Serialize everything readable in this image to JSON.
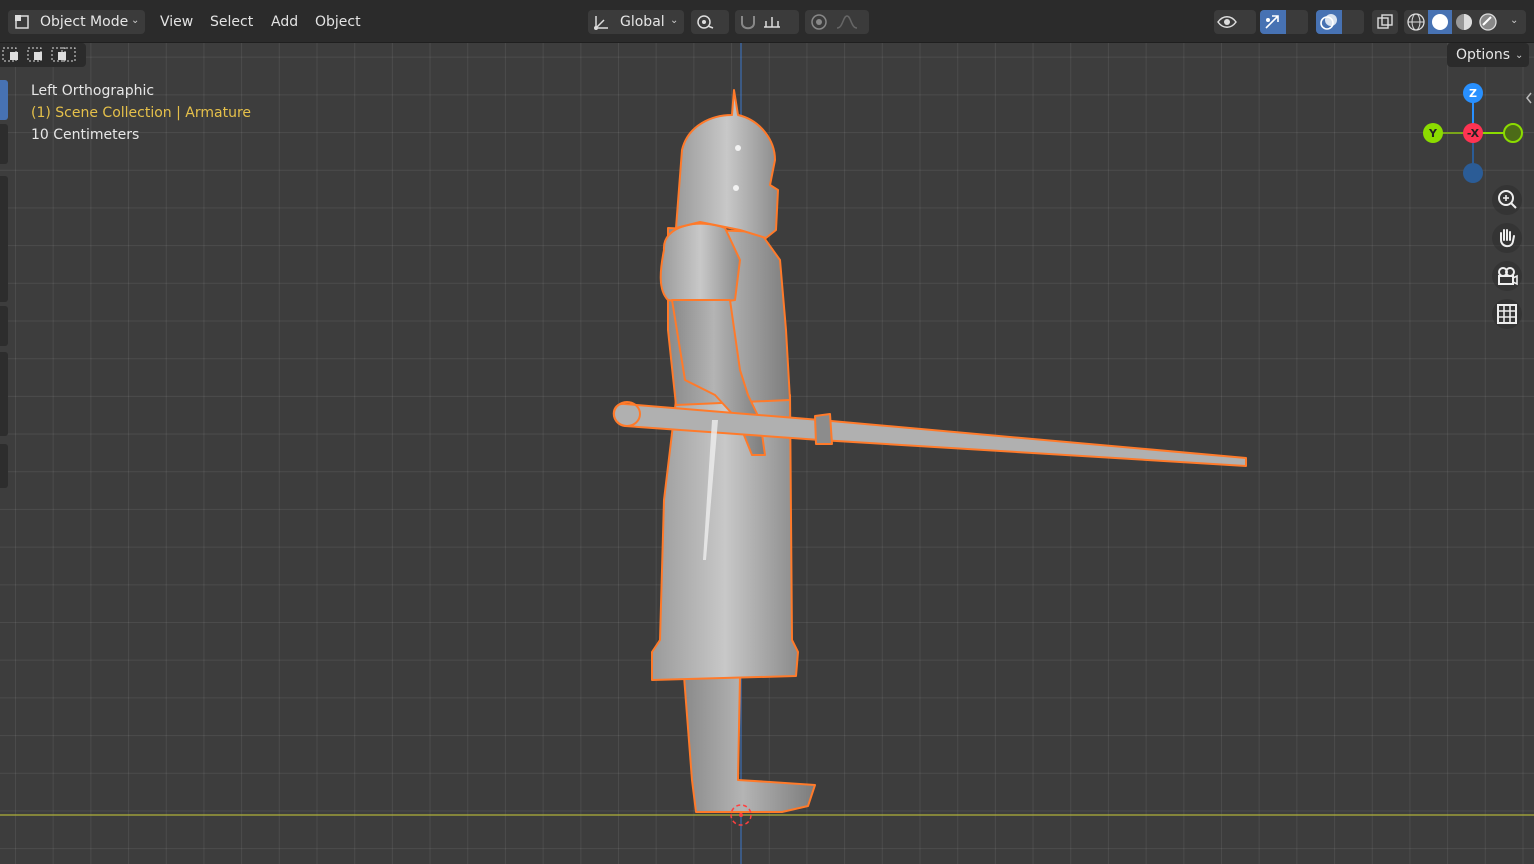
{
  "header": {
    "mode_label": "Object Mode",
    "menus": [
      "View",
      "Select",
      "Add",
      "Object"
    ],
    "transform_orientation": "Global",
    "options_label": "Options"
  },
  "overlay": {
    "view_name": "Left Orthographic",
    "collection": "(1) Scene Collection",
    "active_object": "Armature",
    "scale": "10 Centimeters"
  },
  "gizmo": {
    "z_label": "Z",
    "y_label": "Y",
    "x_label": "-X"
  },
  "icons": {
    "mode": "object-mode-icon",
    "orientation": "transform-axes-icon",
    "pivot": "pivot-point-icon",
    "snap": "snap-magnet-icon",
    "snap_target": "snap-increment-icon",
    "proportional": "proportional-edit-icon",
    "falloff": "falloff-curve-icon",
    "visibility": "eye-icon",
    "gizmo": "gizmo-arrow-icon",
    "overlays": "overlays-icon",
    "xray": "xray-icon",
    "shading_wire": "wireframe-shading-icon",
    "shading_solid": "solid-shading-icon",
    "shading_material": "material-shading-icon",
    "shading_rendered": "rendered-shading-icon",
    "zoom": "zoom-icon",
    "pan": "hand-icon",
    "camera": "camera-icon",
    "ortho": "grid-icon"
  },
  "colors": {
    "selection_outline": "#ff7a2a",
    "active_text": "#e5c04a",
    "axis_x": "#ff3352",
    "axis_y": "#8bdc00",
    "axis_z": "#2890ff"
  }
}
